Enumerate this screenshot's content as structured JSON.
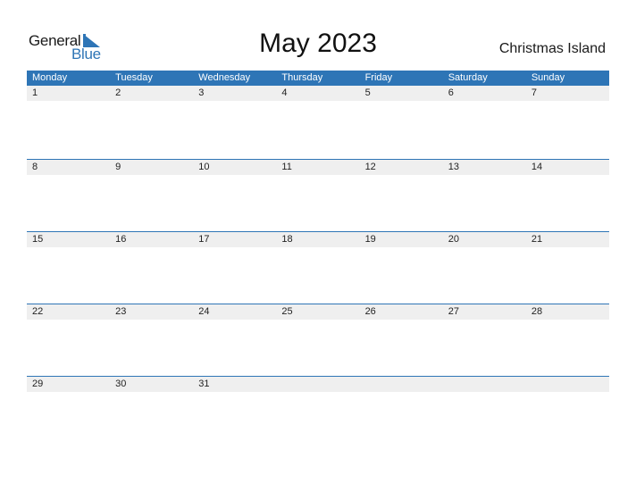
{
  "logo": {
    "word1": "General",
    "word2": "Blue",
    "accent": "#2e75b6"
  },
  "header": {
    "title": "May 2023",
    "region": "Christmas Island"
  },
  "calendar": {
    "weekdays": [
      "Monday",
      "Tuesday",
      "Wednesday",
      "Thursday",
      "Friday",
      "Saturday",
      "Sunday"
    ],
    "weeks": [
      [
        "1",
        "2",
        "3",
        "4",
        "5",
        "6",
        "7"
      ],
      [
        "8",
        "9",
        "10",
        "11",
        "12",
        "13",
        "14"
      ],
      [
        "15",
        "16",
        "17",
        "18",
        "19",
        "20",
        "21"
      ],
      [
        "22",
        "23",
        "24",
        "25",
        "26",
        "27",
        "28"
      ],
      [
        "29",
        "30",
        "31",
        "",
        "",
        "",
        ""
      ]
    ]
  }
}
